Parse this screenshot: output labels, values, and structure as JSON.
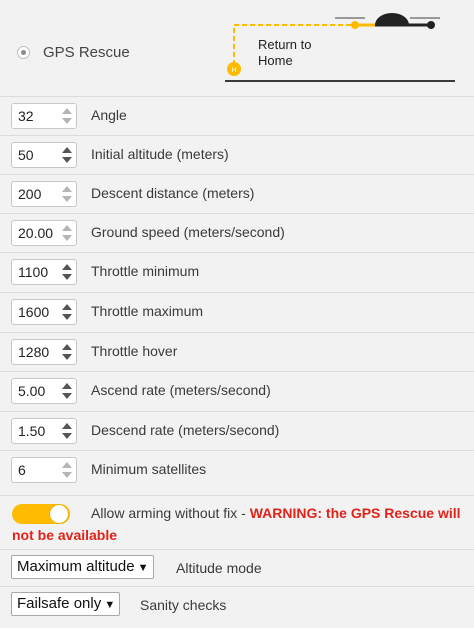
{
  "header": {
    "mode_label": "GPS Rescue",
    "diagram_label_line1": "Return to",
    "diagram_label_line2": "Home",
    "accent_color": "#ffbb00",
    "home_icon": "home-marker-icon",
    "drone_icon": "drone-icon"
  },
  "fields": [
    {
      "value": "32",
      "label": "Angle"
    },
    {
      "value": "50",
      "label": "Initial altitude (meters)"
    },
    {
      "value": "200",
      "label": "Descent distance (meters)"
    },
    {
      "value": "20.00",
      "label": "Ground speed (meters/second)"
    },
    {
      "value": "1100",
      "label": "Throttle minimum"
    },
    {
      "value": "1600",
      "label": "Throttle maximum"
    },
    {
      "value": "1280",
      "label": "Throttle hover"
    },
    {
      "value": "5.00",
      "label": "Ascend rate (meters/second)"
    },
    {
      "value": "1.50",
      "label": "Descend rate (meters/second)"
    },
    {
      "value": "6",
      "label": "Minimum satellites"
    }
  ],
  "arming": {
    "enabled": true,
    "label": "Allow arming without fix - ",
    "warning": "WARNING: the GPS Rescue will not be available",
    "toggle_color": "#ffbb00",
    "warning_color": "#e2231a"
  },
  "altitude_mode": {
    "selected": "Maximum altitude",
    "label": "Altitude mode"
  },
  "sanity_checks": {
    "selected": "Failsafe only",
    "label": "Sanity checks"
  }
}
